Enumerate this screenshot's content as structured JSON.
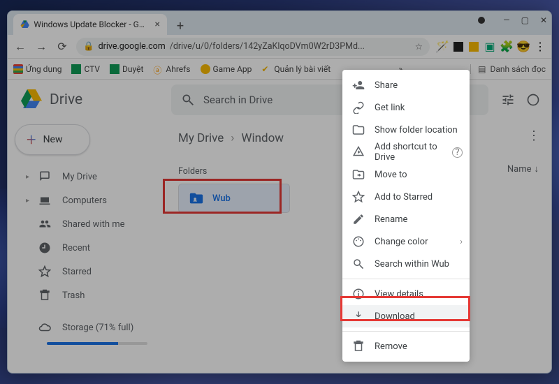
{
  "browser": {
    "tab_title": "Windows Update Blocker - Goog",
    "url_display": {
      "lock": "🔒",
      "host": "drive.google.com",
      "path": "/drive/u/0/folders/142yZaKlqoDVm0W2rD3PMd..."
    },
    "bookmarks": {
      "apps": "Ứng dụng",
      "ctv": "CTV",
      "duyet": "Duyệt",
      "ahrefs": "Ahrefs",
      "gameapp": "Game App",
      "qlbv": "Quản lý bài viết",
      "more": "»",
      "reading_list": "Danh sách đọc"
    }
  },
  "drive": {
    "logo_text": "Drive",
    "search_placeholder": "Search in Drive",
    "new_btn": "New",
    "nav": {
      "mydrive": "My Drive",
      "computers": "Computers",
      "shared": "Shared with me",
      "recent": "Recent",
      "starred": "Starred",
      "trash": "Trash",
      "storage": "Storage (71% full)"
    },
    "breadcrumb": {
      "root": "My Drive",
      "current": "Window"
    },
    "section_label": "Folders",
    "folder_name": "Wub",
    "sort_label": "Name"
  },
  "context_menu": {
    "share": "Share",
    "getlink": "Get link",
    "showloc": "Show folder location",
    "addshortcut": "Add shortcut to Drive",
    "moveto": "Move to",
    "addstar": "Add to Starred",
    "rename": "Rename",
    "changecolor": "Change color",
    "searchwithin": "Search within Wub",
    "viewdetails": "View details",
    "download": "Download",
    "remove": "Remove"
  }
}
